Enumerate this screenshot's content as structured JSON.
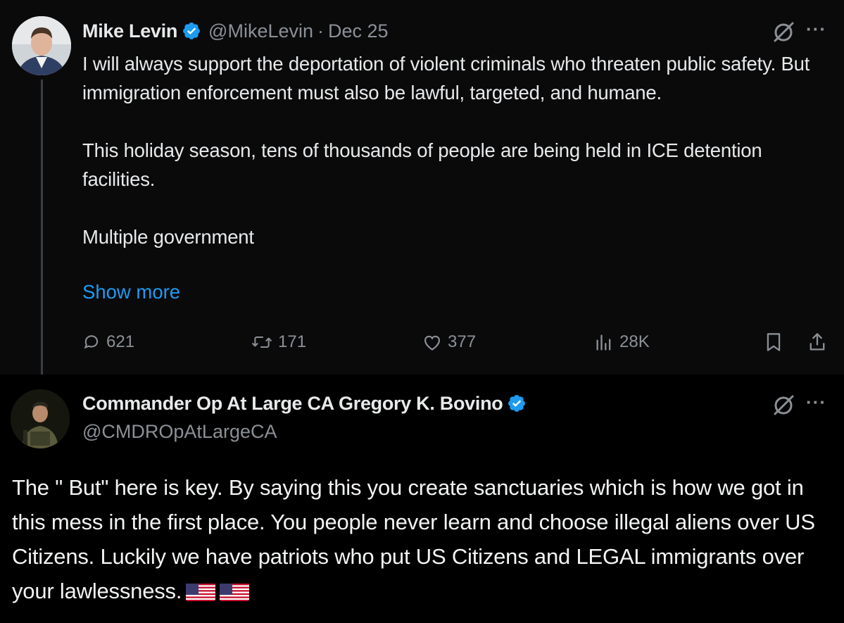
{
  "colors": {
    "accent": "#1d9bf0",
    "muted": "#8b9096",
    "text": "#e7e9ea",
    "verified": "#1d9bf0"
  },
  "tweet": {
    "author_name": "Mike Levin",
    "handle": "@MikeLevin",
    "separator": "·",
    "date": "Dec 25",
    "paragraphs": [
      "I will always support the deportation of violent criminals who threaten public safety. But immigration enforcement must also be lawful, targeted, and humane.",
      "This holiday season, tens of thousands of people are being held in ICE detention facilities.",
      "Multiple government"
    ],
    "show_more": "Show more",
    "actions": {
      "replies": "621",
      "reposts": "171",
      "likes": "377",
      "views": "28K"
    },
    "icons": [
      "verified-badge-icon",
      "grok-icon",
      "more-icon",
      "reply-icon",
      "repost-icon",
      "like-icon",
      "views-icon",
      "bookmark-icon",
      "share-icon"
    ]
  },
  "reply": {
    "author_name": "Commander Op At Large CA Gregory K. Bovino",
    "handle": "@CMDROpAtLargeCA",
    "text": "The \" But\" here is key.  By saying this you create sanctuaries which is how we got in this mess in the first place.  You people never learn and choose illegal aliens over US Citizens.  Luckily we have patriots who put US Citizens and LEGAL immigrants over your lawlessness.",
    "emojis": [
      "us-flag-icon",
      "us-flag-icon"
    ]
  }
}
